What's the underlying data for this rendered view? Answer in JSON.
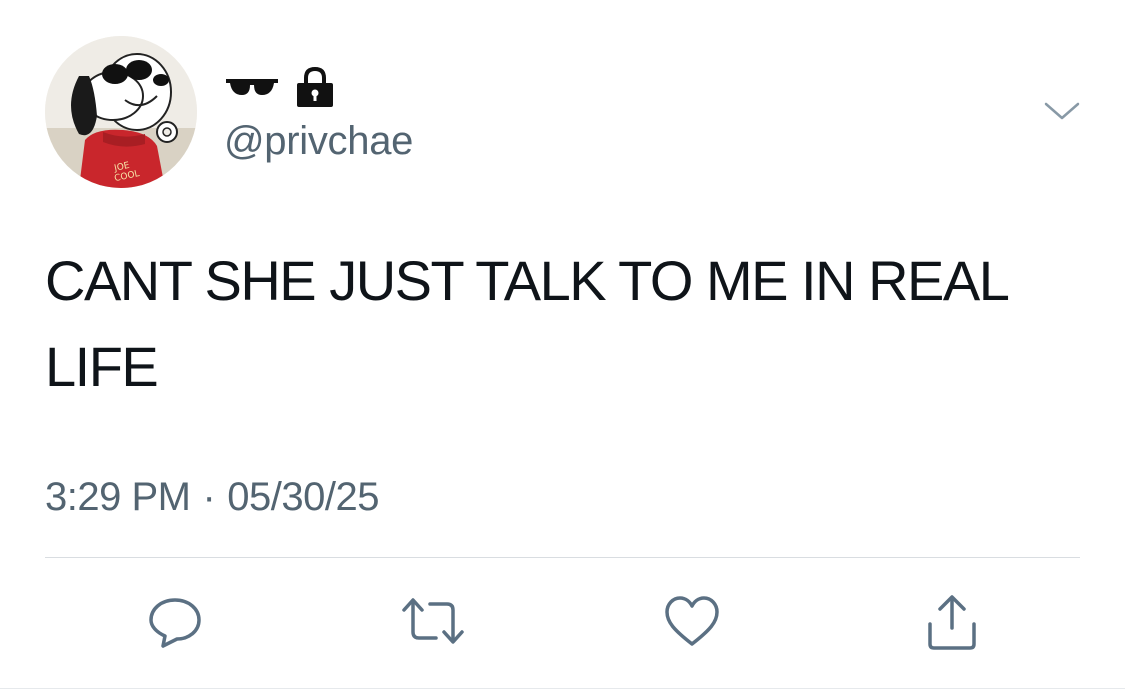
{
  "tweet": {
    "display_name_icons": [
      "sunglasses-icon",
      "lock-icon"
    ],
    "handle": "@privchae",
    "text": "CANT SHE JUST TALK TO ME IN REAL LIFE",
    "time": "3:29 PM",
    "separator": "·",
    "date": "05/30/25"
  },
  "avatar": {
    "shirt_text_line1": "JOE",
    "shirt_text_line2": "COOL"
  },
  "actions": [
    {
      "name": "reply",
      "icon": "reply-icon"
    },
    {
      "name": "retweet",
      "icon": "retweet-icon"
    },
    {
      "name": "like",
      "icon": "heart-icon"
    },
    {
      "name": "share",
      "icon": "share-icon"
    }
  ],
  "colors": {
    "text": "#0f1419",
    "secondary": "#536471",
    "icon": "#5b7083",
    "divider": "#d9dde1"
  }
}
